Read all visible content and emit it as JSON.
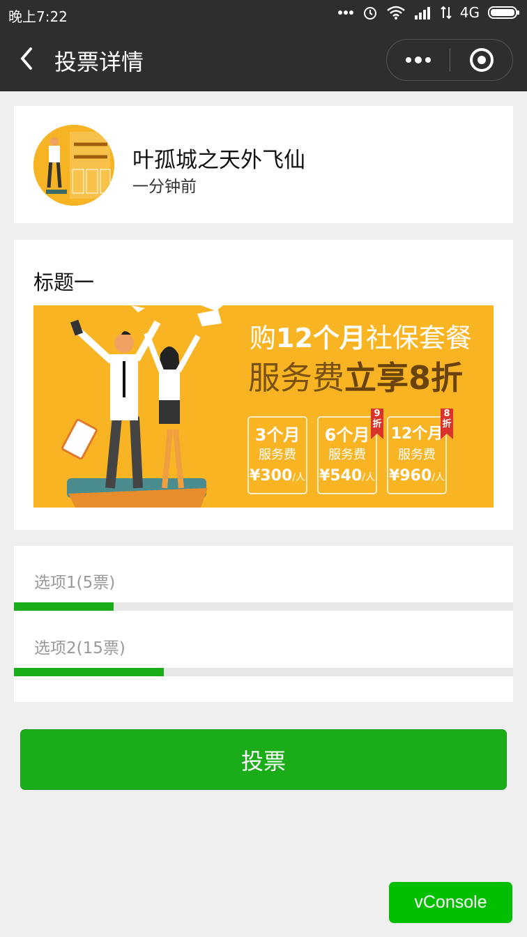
{
  "status_bar": {
    "time": "晚上7:22",
    "network": "4G"
  },
  "nav": {
    "title": "投票详情"
  },
  "author": {
    "name": "叶孤城之天外飞仙",
    "time": "一分钟前"
  },
  "post": {
    "title": "标题一",
    "banner": {
      "line1_prefix": "购",
      "line1_highlight": "12个月",
      "line1_suffix": "社保套餐",
      "line2_prefix": "服务费",
      "line2_highlight": "立享8折",
      "plans": [
        {
          "period": "3个月",
          "label": "服务费",
          "price": "¥300",
          "unit": "/人",
          "discount": ""
        },
        {
          "period": "6个月",
          "label": "服务费",
          "price": "¥540",
          "unit": "/人",
          "discount": "9折"
        },
        {
          "period": "12个月",
          "label": "服务费",
          "price": "¥960",
          "unit": "/人",
          "discount": "8折"
        }
      ]
    }
  },
  "options": [
    {
      "label": "选项1(5票)",
      "progress": 0.2
    },
    {
      "label": "选项2(15票)",
      "progress": 0.3
    }
  ],
  "vote_button": {
    "label": "投票"
  },
  "vconsole": {
    "label": "vConsole"
  },
  "colors": {
    "accent": "#1aad19",
    "nav_bg": "#2e2e2e",
    "banner_bg": "#f8b423"
  }
}
